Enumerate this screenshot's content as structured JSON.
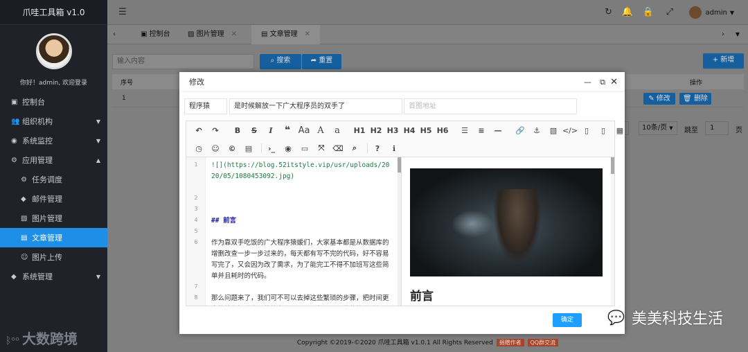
{
  "sidebar": {
    "brand": "爪哇工具箱 v1.0",
    "welcome": "你好！admin, 欢迎登录",
    "items": [
      {
        "icon": "▣",
        "label": "控制台",
        "arrow": ""
      },
      {
        "icon": "👥",
        "label": "组织机构",
        "arrow": "▼"
      },
      {
        "icon": "◉",
        "label": "系统监控",
        "arrow": "▼"
      },
      {
        "icon": "⚙",
        "label": "应用管理",
        "arrow": "▲"
      },
      {
        "icon": "⚙",
        "label": "任务调度",
        "arrow": ""
      },
      {
        "icon": "◆",
        "label": "邮件管理",
        "arrow": ""
      },
      {
        "icon": "▧",
        "label": "图片管理",
        "arrow": ""
      },
      {
        "icon": "▤",
        "label": "文章管理",
        "arrow": ""
      },
      {
        "icon": "☺",
        "label": "图片上传",
        "arrow": ""
      },
      {
        "icon": "◆",
        "label": "系统管理",
        "arrow": "▼"
      }
    ],
    "logo_mark": "ᛒᵒᵒ",
    "logo_text": "大数跨境"
  },
  "topbar": {
    "user": "admin"
  },
  "tabs": [
    {
      "label": "控制台",
      "icon": "▣"
    },
    {
      "label": "图片管理",
      "icon": "▧"
    },
    {
      "label": "文章管理",
      "icon": "▤"
    }
  ],
  "list": {
    "search_placeholder": "输入内容",
    "search_label": "搜索",
    "reset_label": "重置",
    "add_label": "+ 新增",
    "col_index": "序号",
    "col_ops": "操作",
    "row_index": "1",
    "edit_label": "修改",
    "delete_label": "删除",
    "page_size": "10条/页",
    "goto_label": "跳至",
    "goto_value": "1",
    "page_suffix": "页"
  },
  "modal": {
    "title": "修改",
    "category": "程序猿",
    "article_title": "是时候解放一下广大程序员的双手了",
    "cover_placeholder": "首图地址",
    "confirm": "确定"
  },
  "editor": {
    "lines": [
      {
        "n": "1",
        "text": "![](https://blog.52itstyle.vip/usr/uploads/2020/05/1080453092.jpg)"
      },
      {
        "n": "2",
        "text": ""
      },
      {
        "n": "3",
        "text": ""
      },
      {
        "n": "4",
        "text": "## 前言"
      },
      {
        "n": "5",
        "text": ""
      },
      {
        "n": "6",
        "text": "作为靠双手吃饭的广大程序猿媛们，大家基本都是从数据库的增删改查一步一步过来的，每天都有写不完的代码，好不容易写完了，又会因为改了需求，为了能完工不得不加班写这些简单并且耗时的代码。"
      },
      {
        "n": "7",
        "text": ""
      },
      {
        "n": "8",
        "text": "那么问题来了，我们可不可以去掉这些繁琐的步骤，把时间更多的放在提升自己的能力上，而不是每天只是做些简单重复"
      }
    ]
  },
  "preview": {
    "heading": "前言"
  },
  "footer": {
    "copyright": "Copyright ©2019-©2020 爪哇工具箱 v1.0.1 All Rights Reserved",
    "donate": "捐赠作者",
    "qq": "QQ群交流"
  },
  "watermark": "美美科技生活"
}
